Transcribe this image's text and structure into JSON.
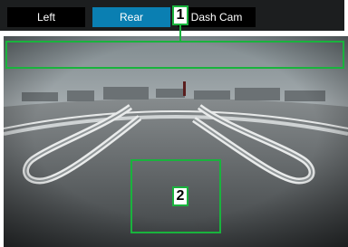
{
  "tabs": [
    {
      "label": "Left",
      "active": false
    },
    {
      "label": "Rear",
      "active": true
    },
    {
      "label": "Dash Cam",
      "active": false
    }
  ],
  "callouts": {
    "tab_bar": "1",
    "touch_area": "2"
  },
  "colors": {
    "accent": "#0a7fb2",
    "callout": "#19b33d",
    "inactive_tab": "#000000"
  }
}
